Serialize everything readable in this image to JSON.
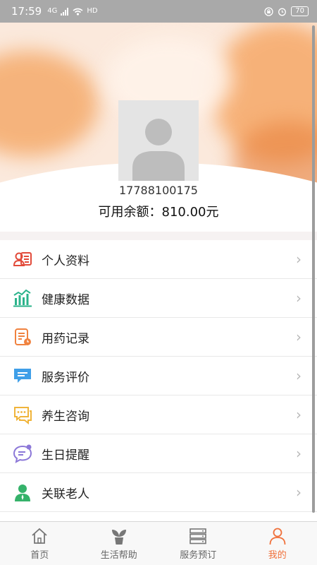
{
  "status_bar": {
    "time": "17:59",
    "network": "4G",
    "hd": "HD",
    "battery": "70"
  },
  "profile": {
    "phone": "17788100175",
    "balance": "可用余额：810.00元"
  },
  "menu": [
    {
      "label": "个人资料",
      "icon": "profile-card-icon",
      "color": "#e24b3b"
    },
    {
      "label": "健康数据",
      "icon": "health-chart-icon",
      "color": "#2bb38b"
    },
    {
      "label": "用药记录",
      "icon": "medication-record-icon",
      "color": "#f0823f"
    },
    {
      "label": "服务评价",
      "icon": "review-chat-icon",
      "color": "#3f9fe8"
    },
    {
      "label": "养生咨询",
      "icon": "consult-chat-icon",
      "color": "#f0b43a"
    },
    {
      "label": "生日提醒",
      "icon": "birthday-bubble-icon",
      "color": "#8c78d8"
    },
    {
      "label": "关联老人",
      "icon": "elder-user-icon",
      "color": "#35b26a"
    }
  ],
  "tabs": [
    {
      "label": "首页",
      "icon": "home-icon",
      "active": false
    },
    {
      "label": "生活帮助",
      "icon": "plant-icon",
      "active": false
    },
    {
      "label": "服务预订",
      "icon": "server-list-icon",
      "active": false
    },
    {
      "label": "我的",
      "icon": "user-icon",
      "active": true
    }
  ],
  "colors": {
    "accent": "#f0703a",
    "status_bar": "#a9a9a9"
  }
}
